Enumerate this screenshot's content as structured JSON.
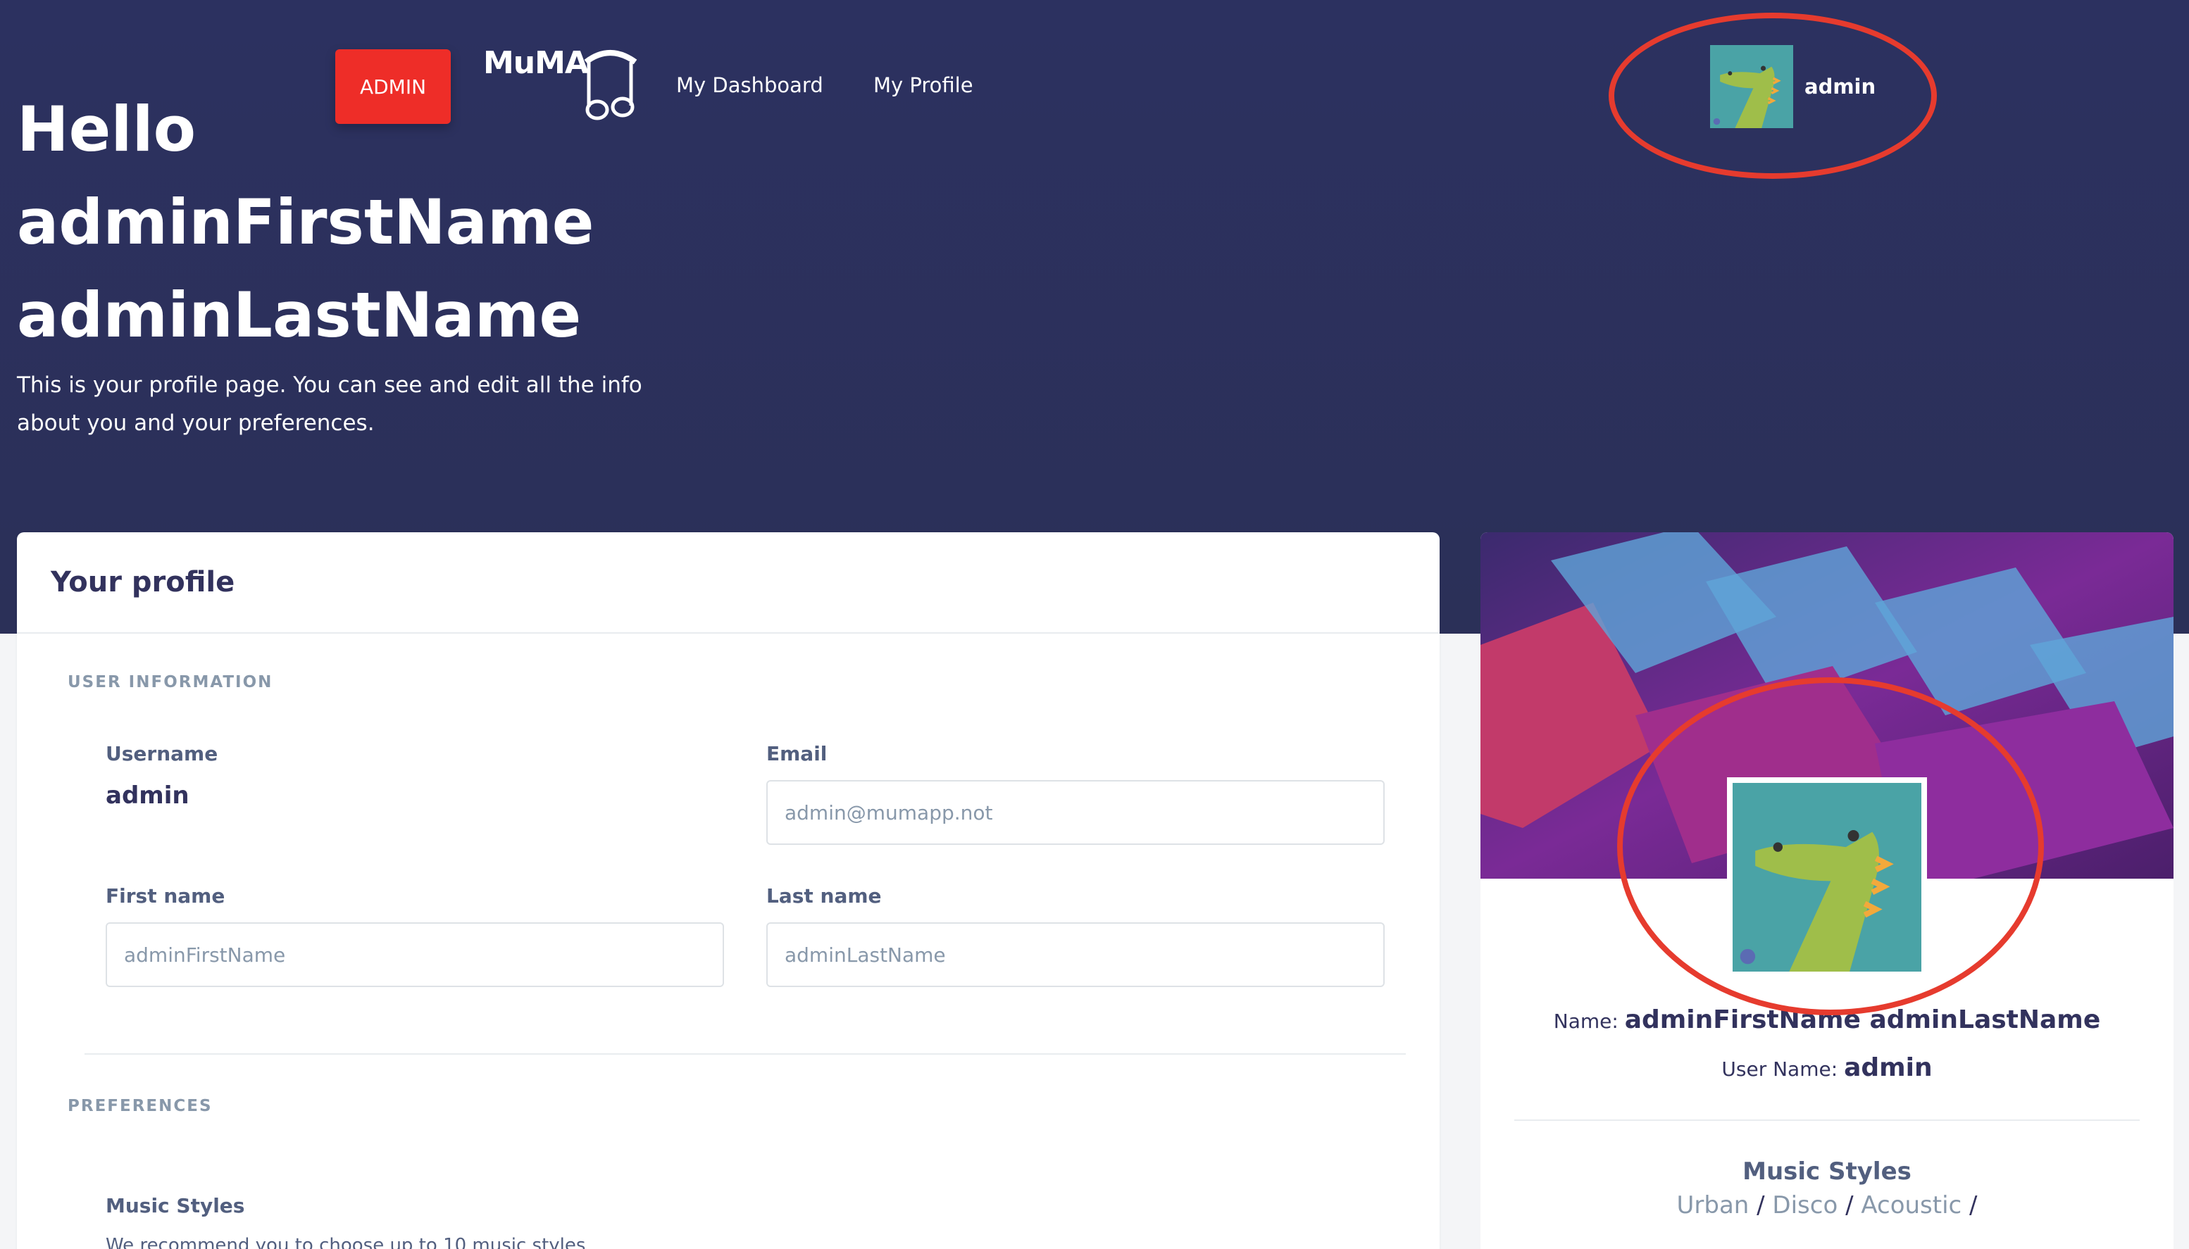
{
  "nav": {
    "admin_label": "ADMIN",
    "brand": "MuMA",
    "links": [
      "My Dashboard",
      "My Profile"
    ],
    "user": "admin"
  },
  "hero": {
    "greeting": "Hello",
    "first": "adminFirstName",
    "last": "adminLastName",
    "subtitle": "This is your profile page. You can see and edit all the info about you and your preferences."
  },
  "profile_form": {
    "title": "Your profile",
    "section_user": "USER INFORMATION",
    "username_label": "Username",
    "username_value": "admin",
    "email_label": "Email",
    "email_placeholder": "admin@mumapp.not",
    "first_label": "First name",
    "first_placeholder": "adminFirstName",
    "last_label": "Last name",
    "last_placeholder": "adminLastName",
    "section_pref": "PREFERENCES",
    "music_label": "Music Styles",
    "music_hint": "We recommend you to choose up to 10 music styles"
  },
  "side_card": {
    "name_label": "Name: ",
    "name_value": "adminFirstName adminLastName",
    "user_label": "User Name: ",
    "user_value": "admin",
    "music_title": "Music Styles",
    "styles": [
      "Urban",
      "Disco",
      "Acoustic"
    ]
  },
  "colors": {
    "hero_bg": "#2c3160",
    "admin_button": "#ee2d28",
    "annotation": "#e63b2e",
    "avatar_bg": "#4aa3a6",
    "croc": "#9fbe4a"
  }
}
